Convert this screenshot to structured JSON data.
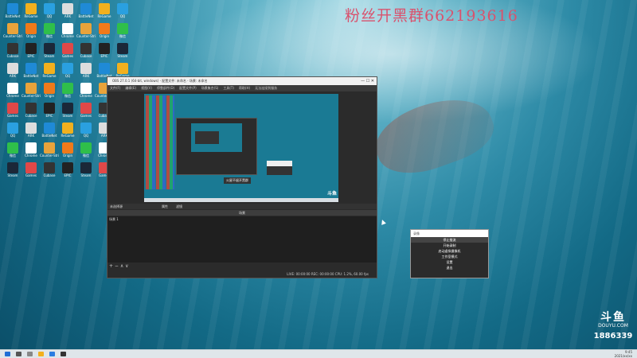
{
  "watermark_top": "粉丝开黑群662193616",
  "desktop_icons": [
    {
      "label": "BattleNet",
      "color": "#1f8ad6"
    },
    {
      "label": "Counter-Strike Global Off",
      "color": "#e8a33b"
    },
    {
      "label": "Cubase",
      "color": "#333333"
    },
    {
      "label": "ARK",
      "color": "#dddddd"
    },
    {
      "label": "Chrome",
      "color": "#ffffff"
    },
    {
      "label": "Games",
      "color": "#e04848"
    },
    {
      "label": "QQ",
      "color": "#2aa0e0"
    },
    {
      "label": "微信",
      "color": "#2fbf4a"
    },
    {
      "label": "Steam",
      "color": "#1b2838"
    },
    {
      "label": "ReGame",
      "color": "#f2b01e"
    },
    {
      "label": "Origin",
      "color": "#f07a1a"
    },
    {
      "label": "EPIC",
      "color": "#222222"
    }
  ],
  "obs": {
    "title": "OBS 27.0.1 (64-bit, windows) - 配置文件: 未命名 - 场景: 未命名",
    "win_controls": "—  ☐  ✕",
    "menu": [
      "文件(F)",
      "编辑(E)",
      "视图(V)",
      "停靠部件(D)",
      "配置文件(P)",
      "场景集合(S)",
      "工具(T)",
      "帮助(H)",
      "无法连接到服务"
    ],
    "preview_caption": "火星不留开黑群",
    "preview_logo": "斗鱼",
    "source_bar_label": "未选择源",
    "source_btn_properties": "属性",
    "source_btn_filters": "滤镜",
    "dock_header": "场景",
    "scenes_header": "场景 1",
    "dock_buttons": "+ − ∧ ∨",
    "status": "LIVE: 00:00:00  REC: 00:00:00  CPU: 1.2%, 60.00 fps"
  },
  "context_menu": {
    "header": "录像",
    "items": [
      {
        "label": "停止推流",
        "active": true
      },
      {
        "label": "开始录制",
        "active": false
      },
      {
        "label": "启动虚拟摄像机",
        "active": false
      },
      {
        "label": "工作室模式",
        "active": false
      },
      {
        "label": "设置",
        "active": false
      },
      {
        "label": "退出",
        "active": false
      }
    ]
  },
  "douyu": {
    "logo": "斗鱼",
    "url": "DOUYU.COM",
    "room": "1886339"
  },
  "taskbar": {
    "time": "9:45",
    "date": "2021/xx/xx"
  }
}
